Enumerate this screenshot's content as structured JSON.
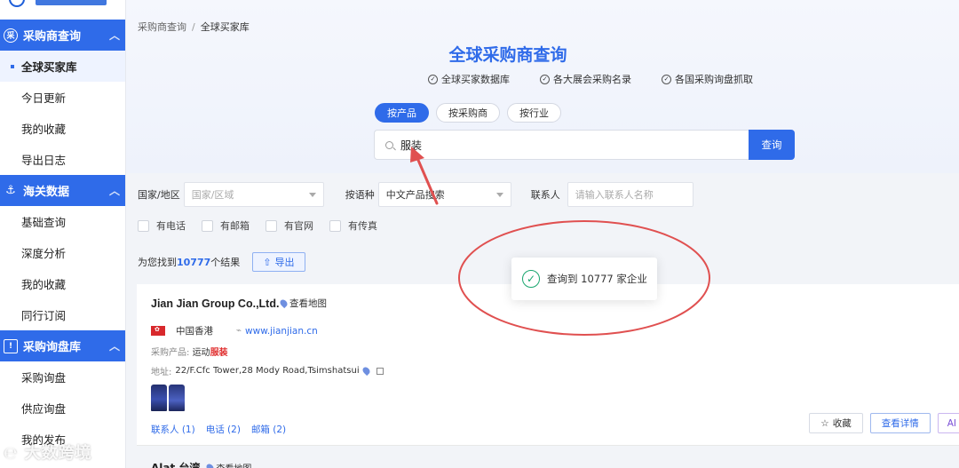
{
  "sidebar": {
    "sections": [
      {
        "title": "采购商查询",
        "icon": "search-company-icon",
        "items": [
          "全球买家库",
          "今日更新",
          "我的收藏",
          "导出日志"
        ]
      },
      {
        "title": "海关数据",
        "icon": "anchor-icon",
        "items": [
          "基础查询",
          "深度分析",
          "我的收藏",
          "同行订阅"
        ]
      },
      {
        "title": "采购询盘库",
        "icon": "inquiry-icon",
        "items": [
          "采购询盘",
          "供应询盘",
          "我的发布"
        ]
      }
    ]
  },
  "breadcrumb": {
    "parent": "采购商查询",
    "separator": "/",
    "current": "全球买家库"
  },
  "hero": {
    "title": "全球采购商查询",
    "features": [
      "全球买家数据库",
      "各大展会采购名录",
      "各国采购询盘抓取"
    ]
  },
  "search_tabs": [
    "按产品",
    "按采购商",
    "按行业"
  ],
  "search": {
    "value": "服装",
    "button": "查询"
  },
  "filters": {
    "country_label": "国家/地区",
    "country_placeholder": "国家/区域",
    "language_label": "按语种",
    "language_value": "中文产品搜索",
    "contact_label": "联系人",
    "contact_placeholder": "请输入联系人名称"
  },
  "checkboxes": [
    "有电话",
    "有邮箱",
    "有官网",
    "有传真"
  ],
  "result": {
    "prefix": "为您找到",
    "count": "10777",
    "suffix": "个结果",
    "export_label": "导出"
  },
  "company": {
    "name": "Jian Jian Group Co.,Ltd.",
    "map_link": "查看地图",
    "region": "中国香港",
    "website": "www.jianjian.cn",
    "product_label": "采购产品:",
    "product_value": "运动",
    "product_highlight": "服装",
    "address_label": "地址:",
    "address_value": "22/F.Cfc Tower,28 Mody Road,Tsimshatsui",
    "contacts": [
      "联系人 (1)",
      "电话 (2)",
      "邮箱 (2)"
    ],
    "buttons": {
      "favorite": "收藏",
      "details": "查看详情",
      "ai": "AI"
    }
  },
  "next_company": {
    "name": "Alat 台湾",
    "map_link": "查看地图"
  },
  "toast": {
    "message": "查询到 10777 家企业"
  },
  "watermark": "大数跨境",
  "colors": {
    "primary": "#2f6be9",
    "highlight": "#e03030",
    "annotation": "#e05050",
    "success": "#1aa66f"
  }
}
